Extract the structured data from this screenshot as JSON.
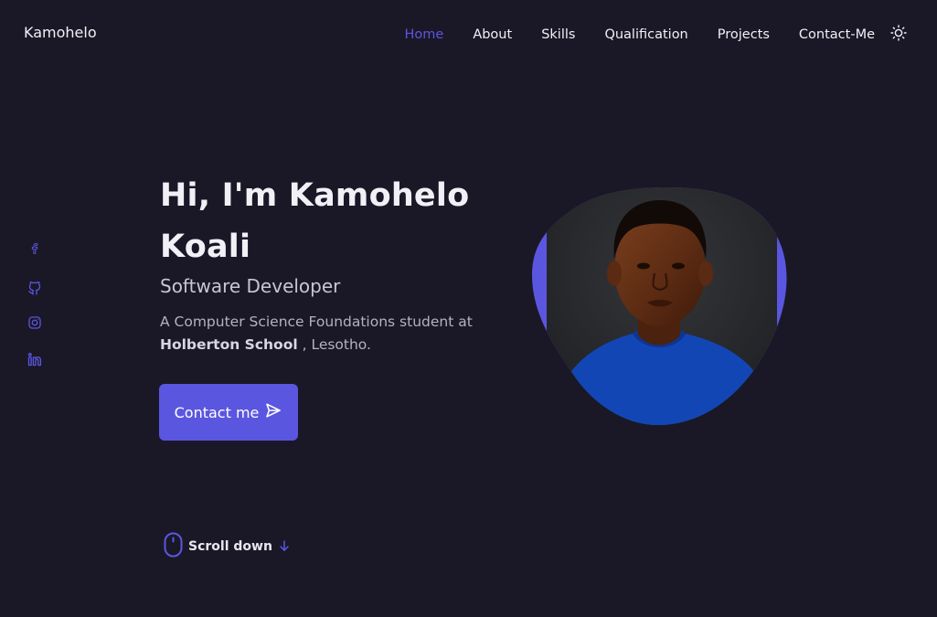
{
  "header": {
    "logo": "Kamohelo",
    "nav": [
      {
        "label": "Home",
        "active": true
      },
      {
        "label": "About"
      },
      {
        "label": "Skills"
      },
      {
        "label": "Qualification"
      },
      {
        "label": "Projects"
      },
      {
        "label": "Contact-Me"
      }
    ],
    "theme_icon": "sun-icon"
  },
  "social": [
    {
      "icon": "facebook-icon"
    },
    {
      "icon": "github-icon"
    },
    {
      "icon": "instagram-icon"
    },
    {
      "icon": "linkedin-icon"
    }
  ],
  "hero": {
    "title_line1": "Hi, I'm Kamohelo",
    "title_line2": "Koali",
    "subtitle": "Software Developer",
    "desc_prefix": "A Computer Science Foundations student at ",
    "desc_school": "Holberton School",
    "desc_suffix": " , Lesotho.",
    "button_label": "Contact me",
    "scroll_label": "Scroll down"
  },
  "colors": {
    "background": "#1a1827",
    "accent": "#5b56e0",
    "text": "#f1f0f6"
  }
}
